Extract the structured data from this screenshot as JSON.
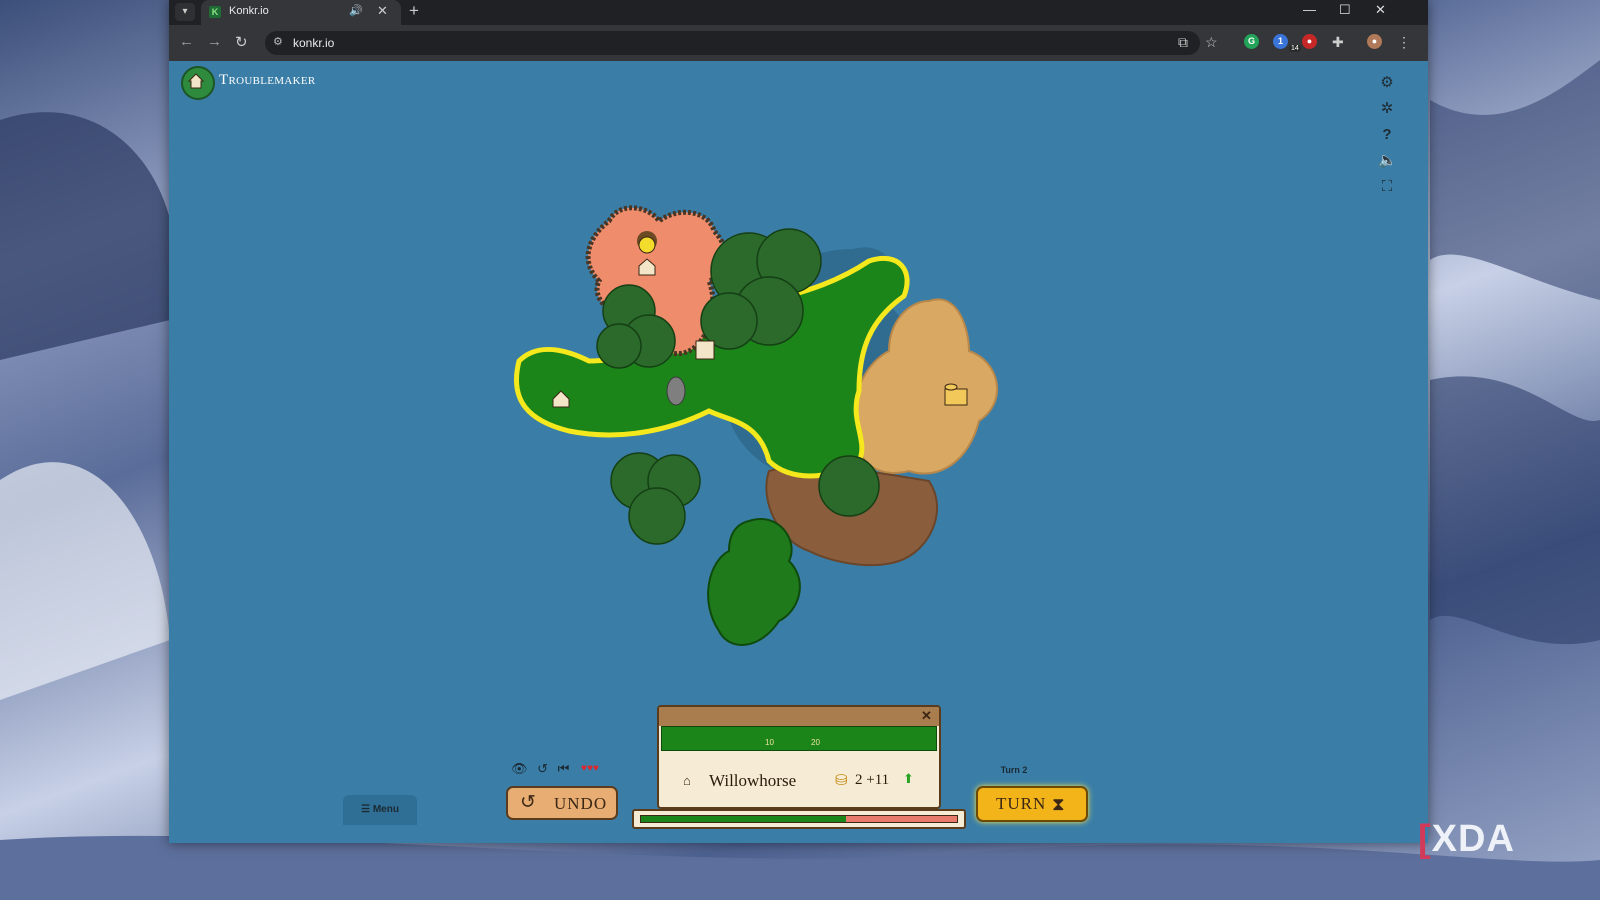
{
  "browser": {
    "tab_title": "Konkr.io",
    "url": "konkr.io",
    "extension_badge": "14"
  },
  "game": {
    "player_name": "Troublemaker",
    "hud": {
      "menu_label": "Menu",
      "undo_label": "UNDO",
      "turn_label": "TURN",
      "turn_indicator": "Turn 2",
      "hearts": "♥♥♥"
    },
    "town_panel": {
      "town_name": "Willowhorse",
      "gold": "2",
      "income": "+11",
      "tier_1_cost": "10",
      "tier_2_cost": "20",
      "progress_fraction": 0.65
    },
    "colors": {
      "sea": "#3a7ea7",
      "player_green": "#1c8519",
      "enemy_salmon": "#ee8c6c",
      "enemy_tan": "#d9a862",
      "enemy_brown": "#8a5e3d",
      "selection_yellow": "#f5e81d"
    }
  },
  "watermark": {
    "brand": "XDA"
  }
}
